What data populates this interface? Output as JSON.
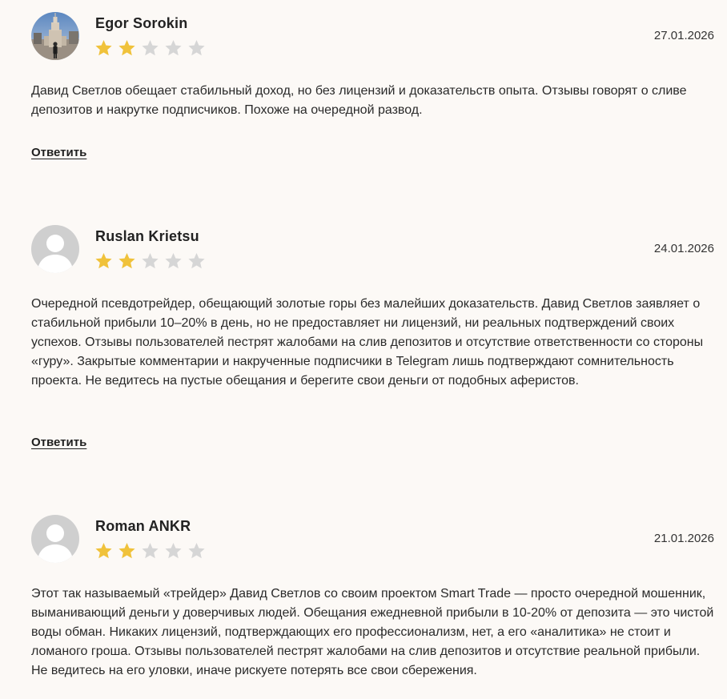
{
  "reviews": [
    {
      "author": "Egor Sorokin",
      "date": "27.01.2026",
      "rating": 2,
      "max_rating": 5,
      "avatar_icon": "user-photo-avatar",
      "text": "Давид Светлов обещает стабильный доход, но без лицензий и доказательств опыта. Отзывы говорят о сливе депозитов и накрутке подписчиков. Похоже на очередной развод.",
      "reply_label": "Ответить"
    },
    {
      "author": "Ruslan Krietsu",
      "date": "24.01.2026",
      "rating": 2,
      "max_rating": 5,
      "avatar_icon": "default-user-avatar",
      "text": "Очередной псевдотрейдер, обещающий золотые горы без малейших доказательств. Давид Светлов заявляет о стабильной прибыли 10–20% в день, но не предоставляет ни лицензий, ни реальных подтверждений своих успехов. Отзывы пользователей пестрят жалобами на слив депозитов и отсутствие ответственности со стороны «гуру». Закрытые комментарии и накрученные подписчики в Telegram лишь подтверждают сомнительность проекта. Не ведитесь на пустые обещания и берегите свои деньги от подобных аферистов.",
      "reply_label": "Ответить"
    },
    {
      "author": "Roman ANKR",
      "date": "21.01.2026",
      "rating": 2,
      "max_rating": 5,
      "avatar_icon": "default-user-avatar",
      "text": "Этот так называемый «трейдер» Давид Светлов со своим проектом Smart Trade — просто очередной мошенник, выманивающий деньги у доверчивых людей. Обещания ежедневной прибыли в 10-20% от депозита — это чистой воды обман. Никаких лицензий, подтверждающих его профессионализм, нет, а его «аналитика» не стоит и ломаного гроша. Отзывы пользователей пестрят жалобами на слив депозитов и отсутствие реальной прибыли. Не ведитесь на его уловки, иначе рискуете потерять все свои сбережения."
    }
  ],
  "colors": {
    "background": "#fcf9f6",
    "star_filled": "#f0c23b",
    "star_empty": "#d6d6d6",
    "avatar_placeholder_bg": "#cfcfcf"
  }
}
